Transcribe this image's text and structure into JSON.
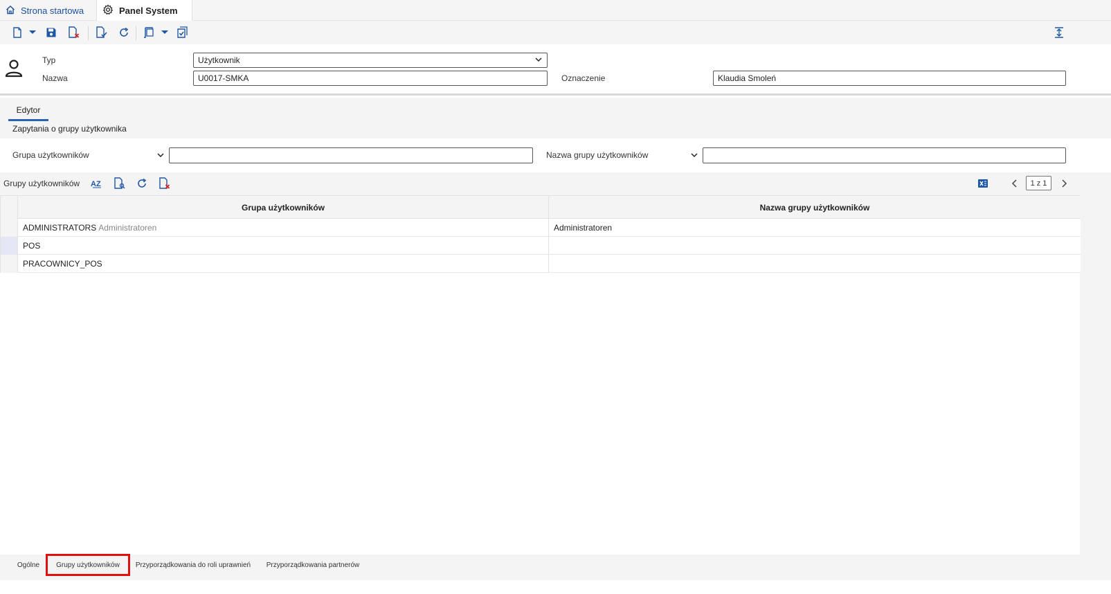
{
  "top_tabs": {
    "home_label": "Strona startowa",
    "active_label": "Panel System"
  },
  "header": {
    "type_label": "Typ",
    "type_value": "Użytkownik",
    "name_label": "Nazwa",
    "name_value": "U0017-SMKA",
    "designation_label": "Oznaczenie",
    "designation_value": "Klaudia Smoleń"
  },
  "editor": {
    "tab_label": "Edytor",
    "query_title": "Zapytania o grupy użytkownika",
    "query_field1_label": "Grupa użytkowników",
    "query_field1_value": "",
    "query_field2_label": "Nazwa grupy użytkowników",
    "query_field2_value": ""
  },
  "grid": {
    "title": "Grupy użytkowników",
    "pager": "1 z 1",
    "columns": [
      "Grupa użytkowników",
      "Nazwa grupy użytkowników"
    ],
    "rows": [
      {
        "group": "ADMINISTRATORS",
        "group_hint": "Administratoren",
        "name": "Administratoren"
      },
      {
        "group": "POS",
        "group_hint": "",
        "name": ""
      },
      {
        "group": "PRACOWNICY_POS",
        "group_hint": "",
        "name": ""
      }
    ]
  },
  "bottom_tabs": {
    "items": [
      "Ogólne",
      "Grupy użytkowników",
      "Przyporządkowania do roli uprawnień",
      "Przyporządkowania partnerów"
    ],
    "active_index": 1
  },
  "colors": {
    "accent": "#2a63b5",
    "highlight": "#e01010"
  }
}
